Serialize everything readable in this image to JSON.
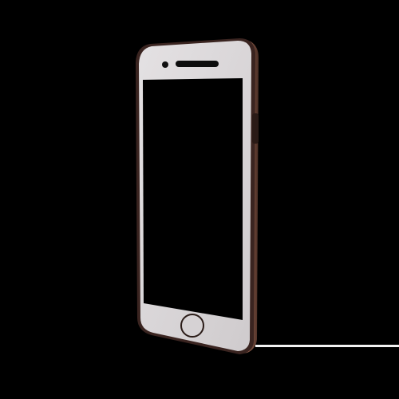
{
  "image": {
    "subject": "smartphone-3d-render",
    "colors": {
      "background": "#000000",
      "frame_edge": "#5a3a30",
      "frame_highlight": "#8a5a48",
      "face": "#d9d6d8",
      "screen": "#000000",
      "speaker": "#0d0d0d",
      "side_button": "#2a1a16",
      "floor_line": "#f2f2f2"
    },
    "icons": [
      "speaker-grille-icon",
      "home-button-icon"
    ]
  }
}
